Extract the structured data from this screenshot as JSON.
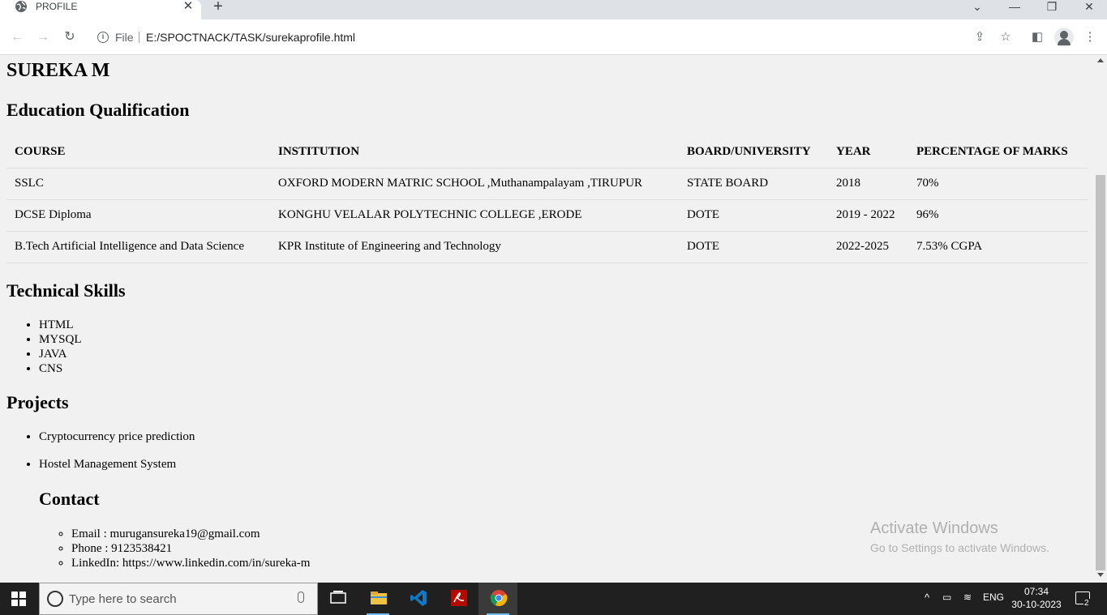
{
  "browser": {
    "tab_title": "PROFILE",
    "scheme_label": "File",
    "url": "E:/SPOCTNACK/TASK/surekaprofile.html",
    "icons": [
      "globe-icon",
      "close-icon",
      "plus-icon",
      "chevron-down-icon",
      "minimize-icon",
      "restore-icon",
      "window-close-icon",
      "back-icon",
      "forward-icon",
      "reload-icon",
      "info-icon",
      "share-icon",
      "star-icon",
      "side-panel-icon",
      "profile-icon",
      "kebab-menu-icon"
    ]
  },
  "page": {
    "name": "SUREKA M",
    "education": {
      "heading": "Education Qualification",
      "columns": [
        "COURSE",
        "INSTITUTION",
        "BOARD/UNIVERSITY",
        "YEAR",
        "PERCENTAGE OF MARKS"
      ],
      "rows": [
        [
          "SSLC",
          "OXFORD MODERN MATRIC SCHOOL ,Muthanampalayam ,TIRUPUR",
          "STATE BOARD",
          "2018",
          "70%"
        ],
        [
          "DCSE Diploma",
          "KONGHU VELALAR POLYTECHNIC COLLEGE ,ERODE",
          "DOTE",
          "2019 - 2022",
          "96%"
        ],
        [
          "B.Tech Artificial Intelligence and Data Science",
          "KPR Institute of Engineering and Technology",
          "DOTE",
          "2022-2025",
          "7.53% CGPA"
        ]
      ]
    },
    "skills": {
      "heading": "Technical Skills",
      "items": [
        "HTML",
        "MYSQL",
        "JAVA",
        "CNS"
      ]
    },
    "projects": {
      "heading": "Projects",
      "items": [
        "Cryptocurrency price prediction",
        "Hostel Management System"
      ]
    },
    "contact": {
      "heading": "Contact",
      "items": [
        "Email : murugansureka19@gmail.com",
        "Phone : 9123538421",
        "LinkedIn: https://www.linkedin.com/in/sureka-m"
      ]
    }
  },
  "watermark": {
    "line1": "Activate Windows",
    "line2": "Go to Settings to activate Windows."
  },
  "taskbar": {
    "search_placeholder": "Type here to search",
    "language": "ENG",
    "time": "07:34",
    "date": "30-10-2023",
    "notification_count": "2",
    "apps": [
      "file-explorer-icon",
      "vscode-icon",
      "acrobat-icon",
      "chrome-icon"
    ]
  }
}
